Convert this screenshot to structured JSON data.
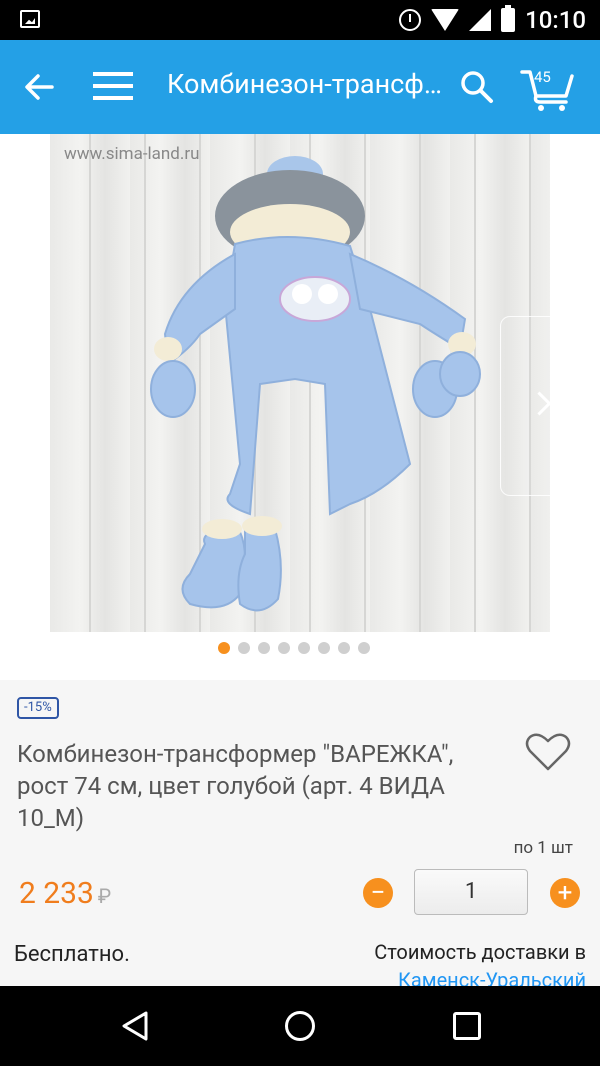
{
  "status_bar": {
    "time": "10:10"
  },
  "appbar": {
    "title": "Комбинезон-трансф…",
    "cart_count": "45"
  },
  "gallery": {
    "watermark": "www.sima-land.ru",
    "dots_count": 8,
    "active_dot": 0
  },
  "product": {
    "discount_badge": "-15%",
    "title": "Комбинезон-трансформер \"ВАРЕЖКА\", рост 74 см, цвет голубой (арт. 4 ВИДА 10_М)",
    "per_unit": "по 1 шт",
    "price": "2 233",
    "currency": "₽",
    "quantity": "1"
  },
  "delivery": {
    "left_text": "Бесплатно.",
    "right_text": "Стоимость доставки в",
    "city": "Каменск-Уральский"
  },
  "colors": {
    "appbar": "#24a0e6",
    "accent_orange": "#f7901e",
    "price_orange": "#f07d1d",
    "link_blue": "#2196f3"
  }
}
